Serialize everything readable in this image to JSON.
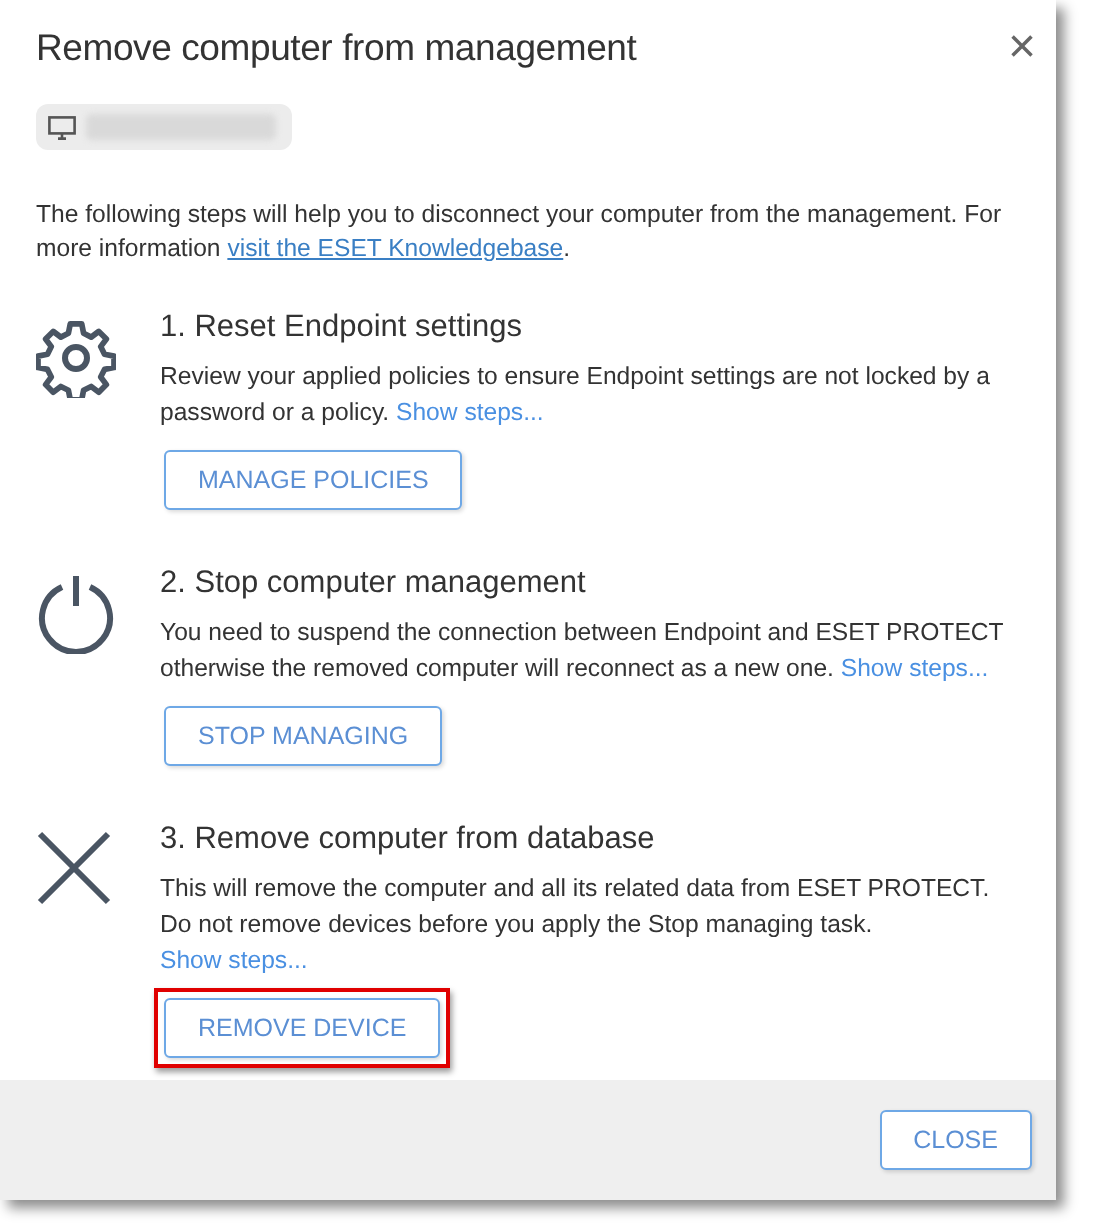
{
  "dialog": {
    "title": "Remove computer from management",
    "close_glyph": "×"
  },
  "intro": {
    "text": "The following steps will help you to disconnect your computer from the management. For more information",
    "link": "visit the ESET Knowledgebase",
    "end": "."
  },
  "steps": [
    {
      "kind": "gear",
      "title": "1. Reset Endpoint settings",
      "text": "Review your applied policies to ensure Endpoint settings are not locked by a password or a policy.",
      "link": "Show steps...",
      "button": "MANAGE POLICIES",
      "highlighted": false
    },
    {
      "kind": "power",
      "title": "2. Stop computer management",
      "text": "You need to suspend the connection between Endpoint and ESET PROTECT otherwise the removed computer will reconnect as a new one.",
      "link": "Show steps...",
      "button": "STOP MANAGING",
      "highlighted": false
    },
    {
      "kind": "cross",
      "title": "3. Remove computer from database",
      "text": "This will remove the computer and all its related data from ESET PROTECT. Do not remove devices before you apply the Stop managing task.",
      "link": "Show steps...",
      "button": "REMOVE DEVICE",
      "highlighted": true
    }
  ],
  "footer": {
    "button": "CLOSE"
  }
}
